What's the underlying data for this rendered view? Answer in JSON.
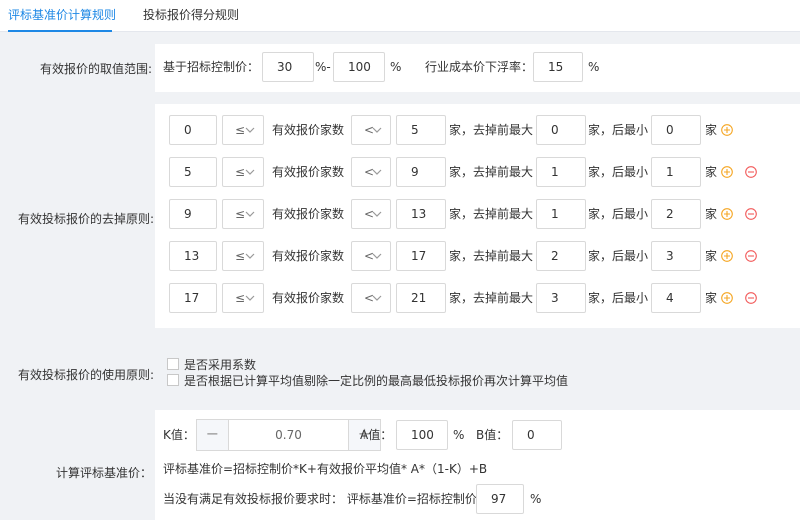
{
  "tabs": [
    "评标基准价计算规则",
    "投标报价得分规则"
  ],
  "range": {
    "label": "有效报价的取值范围:",
    "base": "基于招标控制价：",
    "min": "30",
    "dash": "%-",
    "max": "100",
    "pct": "%",
    "float_label": "行业成本价下浮率：",
    "float": "15",
    "float_pct": "%"
  },
  "removal": {
    "label": "有效投标报价的去掉原则:",
    "op": "≤",
    "count_label": "有效报价家数",
    "lt": "<",
    "remove_max": "家，去掉前最大",
    "remove_min": "家，后最小",
    "unit": "家",
    "rows": [
      {
        "from": "0",
        "to": "5",
        "max": "0",
        "min": "0"
      },
      {
        "from": "5",
        "to": "9",
        "max": "1",
        "min": "1"
      },
      {
        "from": "9",
        "to": "13",
        "max": "1",
        "min": "2"
      },
      {
        "from": "13",
        "to": "17",
        "max": "2",
        "min": "3"
      },
      {
        "from": "17",
        "to": "21",
        "max": "3",
        "min": "4"
      }
    ]
  },
  "usage": {
    "label": "有效投标报价的使用原则:",
    "opt1": "是否采用系数",
    "opt2": "是否根据已计算平均值剔除一定比例的最高最低投标报价再次计算平均值"
  },
  "calc": {
    "label": "计算评标基准价：",
    "k_label": "K值：",
    "k": "0.70",
    "a_label": "A值：",
    "a": "100",
    "a_pct": "%",
    "b_label": "B值：",
    "b": "0",
    "formula": "评标基准价=招标控制价*K+有效报价平均值* A*（1-K）+B",
    "fallback_label": "当没有满足有效投标报价要求时：  评标基准价=招标控制价*",
    "fallback": "97",
    "fallback_pct": "%"
  },
  "colors": {
    "accent": "#1e88e5",
    "add": "#f5a623",
    "remove": "#f25b5b"
  }
}
